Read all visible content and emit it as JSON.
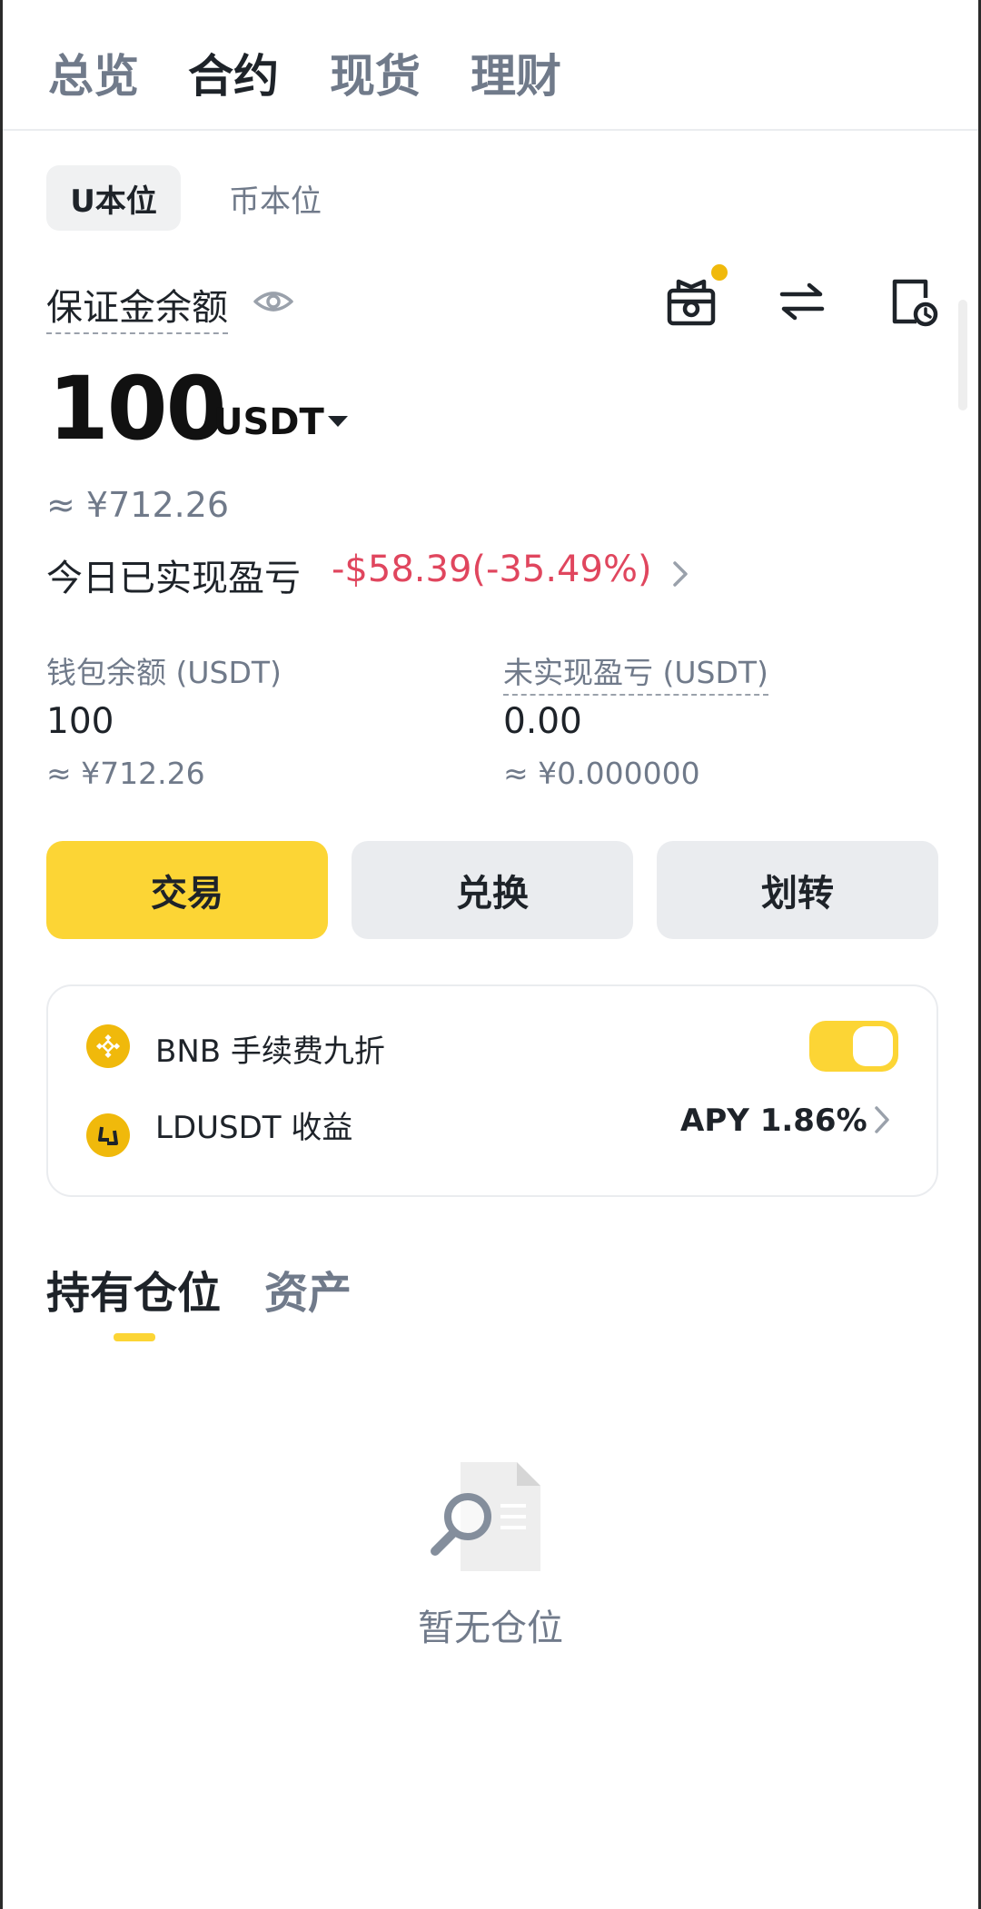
{
  "top_tabs": [
    {
      "label": "总览"
    },
    {
      "label": "合约"
    },
    {
      "label": "现货"
    },
    {
      "label": "理财"
    }
  ],
  "sub_tabs": [
    {
      "label": "U本位"
    },
    {
      "label": "币本位"
    }
  ],
  "account": {
    "margin_label": "保证金余额",
    "balance": "100",
    "balance_unit": "USDT",
    "balance_cny": "≈ ¥712.26",
    "today_pnl_label": "今日已实现盈亏",
    "today_pnl_value": "-$58.39(-35.49%)",
    "wallet_label": "钱包余额 (USDT)",
    "wallet_value": "100",
    "wallet_cny": "≈ ¥712.26",
    "unrealized_label": "未实现盈亏 (USDT)",
    "unrealized_value": "0.00",
    "unrealized_cny": "≈ ¥0.000000"
  },
  "header_icons": [
    "gift-icon",
    "transfer-arrows-icon",
    "history-clock-icon"
  ],
  "actions": [
    {
      "label": "交易"
    },
    {
      "label": "兑换"
    },
    {
      "label": "划转"
    }
  ],
  "card": {
    "bnb_label": "BNB 手续费九折",
    "bnb_enabled": true,
    "ldusdt_label": "LDUSDT 收益",
    "apy": "APY 1.86%"
  },
  "section_tabs": [
    {
      "label": "持有仓位"
    },
    {
      "label": "资产"
    }
  ],
  "empty_state": {
    "text": "暂无仓位"
  },
  "colors": {
    "accent": "#fcd535",
    "negative": "#e0465e",
    "muted": "#707a8a",
    "text": "#1e2329"
  }
}
